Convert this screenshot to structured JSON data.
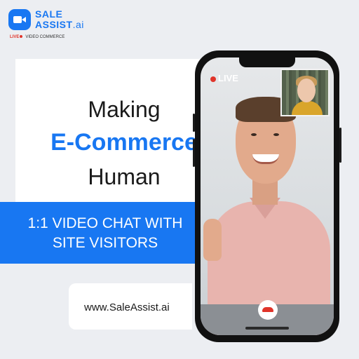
{
  "logo": {
    "icon": "video-camera-icon",
    "line1": "SALE",
    "line2_main": "ASSIST",
    "line2_suffix": ".ai",
    "tag_live": "LIVE",
    "tag_rest": "VIDEO COMMERCE"
  },
  "headline": {
    "line1": "Making",
    "line2": "E-Commerce",
    "line3": "Human"
  },
  "banner": {
    "text": "1:1 VIDEO CHAT WITH\nSITE VISITORS"
  },
  "website": {
    "url": "www.SaleAssist.ai"
  },
  "phone": {
    "live_label": "LIVE",
    "end_call_icon": "end-call-icon"
  },
  "colors": {
    "brand": "#1877f2",
    "live_red": "#e0342a",
    "background": "#eceef2"
  }
}
